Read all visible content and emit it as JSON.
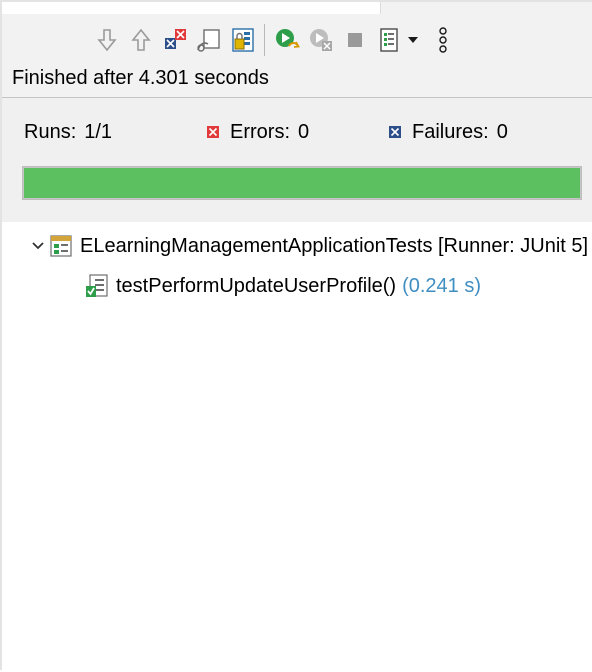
{
  "toolbar": {
    "buttons": [
      {
        "name": "next-failure-button",
        "icon": "arrow-down-icon"
      },
      {
        "name": "previous-failure-button",
        "icon": "arrow-up-icon"
      },
      {
        "name": "show-failures-only-button",
        "icon": "failures-only-icon"
      },
      {
        "name": "scroll-lock-button",
        "icon": "scroll-lock-icon"
      },
      {
        "name": "history-button",
        "icon": "history-icon"
      },
      {
        "name": "rerun-test-button",
        "icon": "rerun-icon"
      },
      {
        "name": "rerun-failed-first-button",
        "icon": "rerun-failed-first-icon"
      },
      {
        "name": "stop-button",
        "icon": "stop-icon"
      },
      {
        "name": "test-run-history-button",
        "icon": "run-history-icon"
      },
      {
        "name": "history-dropdown-button",
        "icon": "dropdown-triangle-icon"
      },
      {
        "name": "view-menu-button",
        "icon": "vertical-ellipsis-icon"
      }
    ]
  },
  "status": {
    "text": "Finished after 4.301 seconds"
  },
  "counters": {
    "runs_label": "Runs:",
    "runs_value": "1/1",
    "errors_label": "Errors:",
    "errors_value": "0",
    "failures_label": "Failures:",
    "failures_value": "0"
  },
  "progress": {
    "fraction": 1.0,
    "color": "#5cbf60"
  },
  "tree": {
    "root": {
      "label": "ELearningManagementApplicationTests [Runner: JUnit 5]",
      "expanded": true,
      "icon": "test-suite-passed-icon"
    },
    "children": [
      {
        "label": "testPerformUpdateUserProfile()",
        "time": "(0.241 s)",
        "icon": "test-case-passed-icon"
      }
    ]
  },
  "colors": {
    "success": "#5cbf60",
    "error_icon": "#e23a3a",
    "failure_icon": "#2c4f8a",
    "time_text": "#3f8ec2"
  }
}
